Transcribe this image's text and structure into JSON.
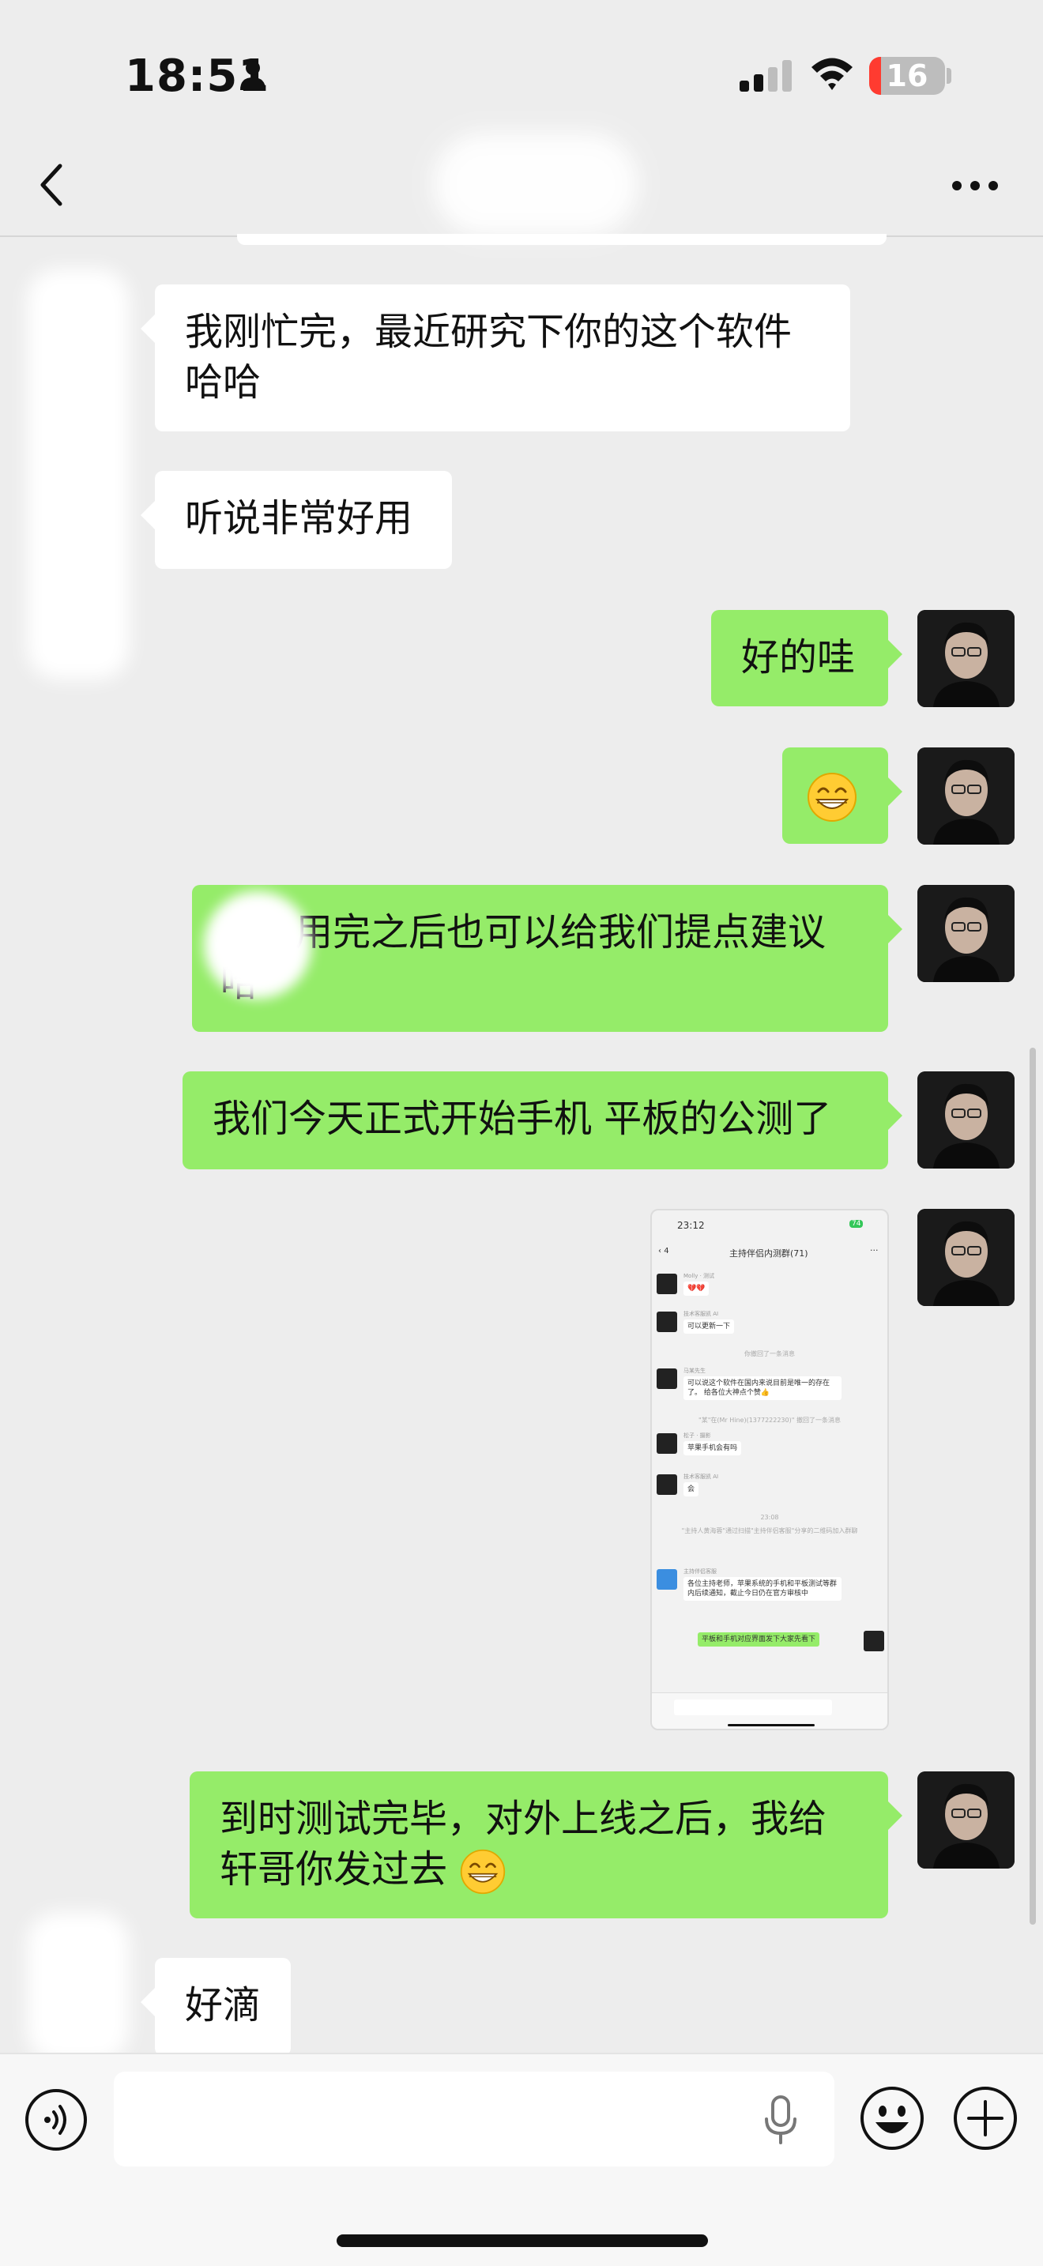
{
  "status_bar": {
    "time": "18:51",
    "battery": "16",
    "battery_level_percent": 16
  },
  "nav": {
    "back": "back-icon",
    "more": "more-icon"
  },
  "messages": [
    {
      "from": "other",
      "text_lines": [
        "我刚忙完，最近研究下你的这个软件",
        "哈哈"
      ]
    },
    {
      "from": "other",
      "text": "听说非常好用"
    },
    {
      "from": "me",
      "text": "好的哇"
    },
    {
      "from": "me",
      "emoji": "grinning-face-emoji"
    },
    {
      "from": "me",
      "text_lines": [
        "用完之后也可以给我们提点建议",
        "哈"
      ]
    },
    {
      "from": "me",
      "text": "我们今天正式开始手机 平板的公测了"
    },
    {
      "from": "me",
      "image": "screenshot"
    },
    {
      "from": "me",
      "text_lines": [
        "到时测试完毕，对外上线之后，我给",
        "轩哥你发过去"
      ],
      "emoji": "grinning-face-emoji"
    },
    {
      "from": "other",
      "text": "好滴"
    }
  ],
  "screenshot": {
    "time": "23:12",
    "battery": "74",
    "title": "主持伴侣内测群(71)",
    "back_count": "4",
    "items": [
      {
        "name": "Molly · 测试",
        "text": "💔💔"
      },
      {
        "name": "技术客服凯 AI",
        "text": "可以更新一下"
      },
      {
        "system": "你撤回了一条消息"
      },
      {
        "name": "马某先生",
        "text": "可以说这个软件在国内来说目前是唯一的存在了。 给各位大神点个赞👍"
      },
      {
        "system": "\"某\"在(Mr Hine)(1377222230)\" 撤回了一条消息"
      },
      {
        "name": "松子 · 摄影",
        "text": "苹果手机会有吗"
      },
      {
        "name": "技术客服凯 AI",
        "text": "会"
      },
      {
        "system": "23:08"
      },
      {
        "system": "\"主持人黄海蓉\"通过扫描\"主持伴侣客服\"分享的二维码加入群聊"
      },
      {
        "name": "主持伴侣客服",
        "text": "各位主持老师，苹果系统的手机和平板测试等群内后续通知，截止今日仍在官方审核中"
      },
      {
        "text": "平板和手机对应界面发下大家先看下",
        "mine": true
      }
    ]
  }
}
